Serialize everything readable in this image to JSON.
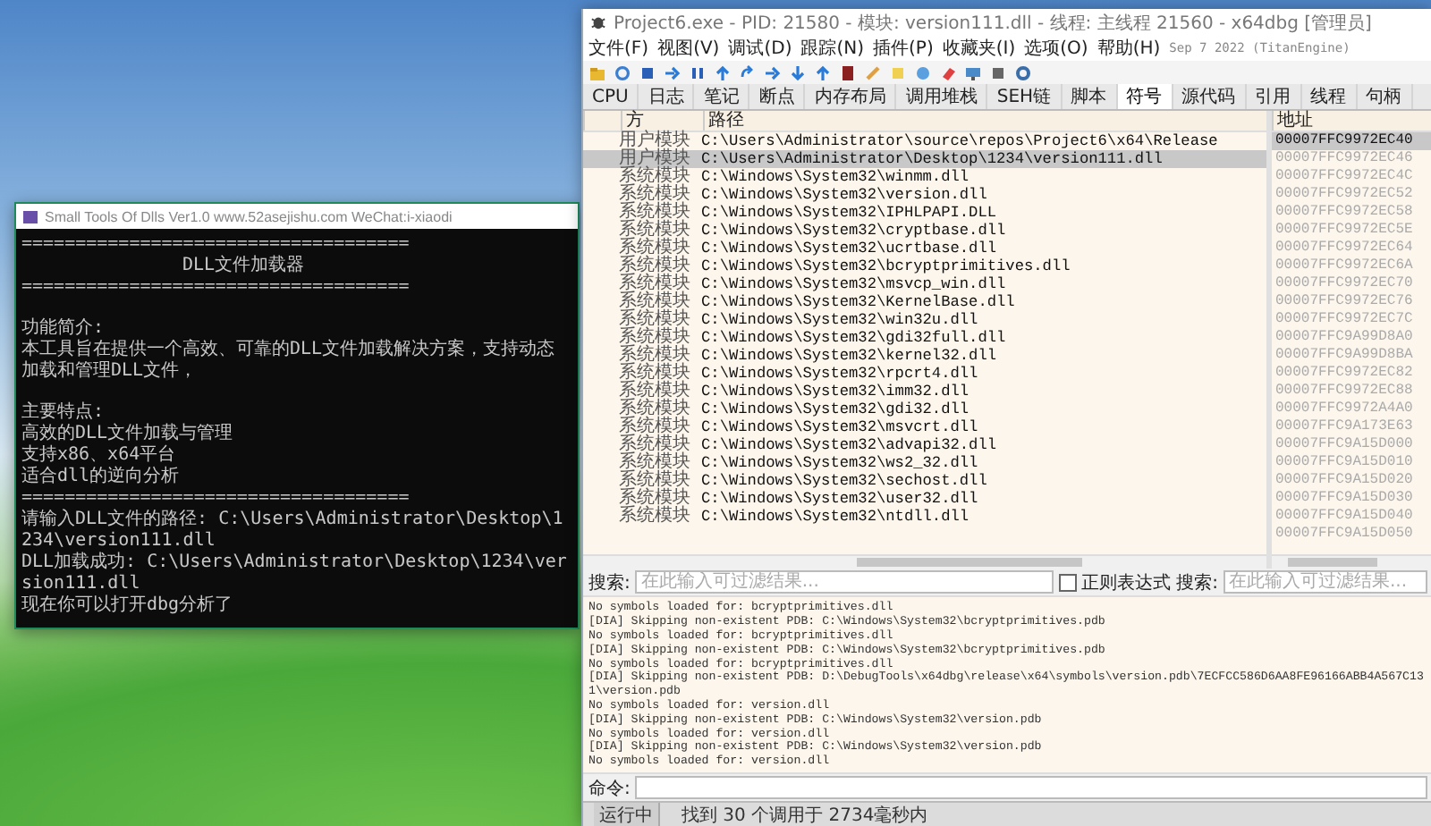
{
  "console": {
    "title": "Small Tools Of Dlls Ver1.0  www.52asejishu.com  WeChat:i-xiaodi",
    "groups": [
      [
        "====================================",
        "DLL文件加载器",
        "===================================="
      ],
      [
        "功能简介:",
        "本工具旨在提供一个高效、可靠的DLL文件加载解决方案，支持动态加载和管理DLL文件，"
      ],
      [
        "主要特点:",
        "高效的DLL文件加载与管理",
        "支持x86、x64平台",
        "适合dll的逆向分析",
        "====================================",
        "请输入DLL文件的路径: C:\\Users\\Administrator\\Desktop\\1234\\version111.dll",
        "DLL加载成功: C:\\Users\\Administrator\\Desktop\\1234\\version111.dll",
        "现在你可以打开dbg分析了"
      ]
    ]
  },
  "debugger": {
    "title": "Project6.exe - PID: 21580 - 模块: version111.dll - 线程: 主线程 21560 - x64dbg [管理员]",
    "menu": [
      "文件(F)",
      "视图(V)",
      "调试(D)",
      "跟踪(N)",
      "插件(P)",
      "收藏夹(I)",
      "选项(O)",
      "帮助(H)"
    ],
    "build_date": "Sep 7 2022 (TitanEngine)",
    "tabs": [
      {
        "label": "CPU",
        "selected": false
      },
      {
        "label": "日志",
        "selected": false
      },
      {
        "label": "笔记",
        "selected": false
      },
      {
        "label": "断点",
        "selected": false
      },
      {
        "label": "内存布局",
        "selected": false
      },
      {
        "label": "调用堆栈",
        "selected": false
      },
      {
        "label": "SEH链",
        "selected": false
      },
      {
        "label": "脚本",
        "selected": false
      },
      {
        "label": "符号",
        "selected": true
      },
      {
        "label": "源代码",
        "selected": false
      },
      {
        "label": "引用",
        "selected": false
      },
      {
        "label": "线程",
        "selected": false
      },
      {
        "label": "句柄",
        "selected": false
      }
    ],
    "modules": {
      "columns": [
        "方",
        "路径"
      ],
      "rows": [
        {
          "type": "用户模块",
          "path": "C:\\Users\\Administrator\\source\\repos\\Project6\\x64\\Release",
          "selected": false
        },
        {
          "type": "用户模块",
          "path": "C:\\Users\\Administrator\\Desktop\\1234\\version111.dll",
          "selected": true
        },
        {
          "type": "系统模块",
          "path": "C:\\Windows\\System32\\winmm.dll",
          "selected": false
        },
        {
          "type": "系统模块",
          "path": "C:\\Windows\\System32\\version.dll",
          "selected": false
        },
        {
          "type": "系统模块",
          "path": "C:\\Windows\\System32\\IPHLPAPI.DLL",
          "selected": false
        },
        {
          "type": "系统模块",
          "path": "C:\\Windows\\System32\\cryptbase.dll",
          "selected": false
        },
        {
          "type": "系统模块",
          "path": "C:\\Windows\\System32\\ucrtbase.dll",
          "selected": false
        },
        {
          "type": "系统模块",
          "path": "C:\\Windows\\System32\\bcryptprimitives.dll",
          "selected": false
        },
        {
          "type": "系统模块",
          "path": "C:\\Windows\\System32\\msvcp_win.dll",
          "selected": false
        },
        {
          "type": "系统模块",
          "path": "C:\\Windows\\System32\\KernelBase.dll",
          "selected": false
        },
        {
          "type": "系统模块",
          "path": "C:\\Windows\\System32\\win32u.dll",
          "selected": false
        },
        {
          "type": "系统模块",
          "path": "C:\\Windows\\System32\\gdi32full.dll",
          "selected": false
        },
        {
          "type": "系统模块",
          "path": "C:\\Windows\\System32\\kernel32.dll",
          "selected": false
        },
        {
          "type": "系统模块",
          "path": "C:\\Windows\\System32\\rpcrt4.dll",
          "selected": false
        },
        {
          "type": "系统模块",
          "path": "C:\\Windows\\System32\\imm32.dll",
          "selected": false
        },
        {
          "type": "系统模块",
          "path": "C:\\Windows\\System32\\gdi32.dll",
          "selected": false
        },
        {
          "type": "系统模块",
          "path": "C:\\Windows\\System32\\msvcrt.dll",
          "selected": false
        },
        {
          "type": "系统模块",
          "path": "C:\\Windows\\System32\\advapi32.dll",
          "selected": false
        },
        {
          "type": "系统模块",
          "path": "C:\\Windows\\System32\\ws2_32.dll",
          "selected": false
        },
        {
          "type": "系统模块",
          "path": "C:\\Windows\\System32\\sechost.dll",
          "selected": false
        },
        {
          "type": "系统模块",
          "path": "C:\\Windows\\System32\\user32.dll",
          "selected": false
        },
        {
          "type": "系统模块",
          "path": "C:\\Windows\\System32\\ntdll.dll",
          "selected": false
        }
      ]
    },
    "addresses": {
      "column": "地址",
      "rows": [
        {
          "value": "00007FFC9972EC40",
          "selected": true
        },
        {
          "value": "00007FFC9972EC46",
          "selected": false
        },
        {
          "value": "00007FFC9972EC4C",
          "selected": false
        },
        {
          "value": "00007FFC9972EC52",
          "selected": false
        },
        {
          "value": "00007FFC9972EC58",
          "selected": false
        },
        {
          "value": "00007FFC9972EC5E",
          "selected": false
        },
        {
          "value": "00007FFC9972EC64",
          "selected": false
        },
        {
          "value": "00007FFC9972EC6A",
          "selected": false
        },
        {
          "value": "00007FFC9972EC70",
          "selected": false
        },
        {
          "value": "00007FFC9972EC76",
          "selected": false
        },
        {
          "value": "00007FFC9972EC7C",
          "selected": false
        },
        {
          "value": "00007FFC9A99D8A0",
          "selected": false
        },
        {
          "value": "00007FFC9A99D8BA",
          "selected": false
        },
        {
          "value": "00007FFC9972EC82",
          "selected": false
        },
        {
          "value": "00007FFC9972EC88",
          "selected": false
        },
        {
          "value": "00007FFC9972A4A0",
          "selected": false
        },
        {
          "value": "00007FFC9A173E63",
          "selected": false
        },
        {
          "value": "00007FFC9A15D000",
          "selected": false
        },
        {
          "value": "00007FFC9A15D010",
          "selected": false
        },
        {
          "value": "00007FFC9A15D020",
          "selected": false
        },
        {
          "value": "00007FFC9A15D030",
          "selected": false
        },
        {
          "value": "00007FFC9A15D040",
          "selected": false
        },
        {
          "value": "00007FFC9A15D050",
          "selected": false
        }
      ]
    },
    "search": {
      "label": "搜索:",
      "placeholder": "在此输入可过滤结果..."
    },
    "regex": {
      "label": "正则表达式",
      "checked": false
    },
    "search_right": {
      "label": "搜索:",
      "placeholder": "在此输入可过滤结果..."
    },
    "log": [
      "No symbols loaded for: bcryptprimitives.dll",
      "[DIA] Skipping non-existent PDB: C:\\Windows\\System32\\bcryptprimitives.pdb",
      "No symbols loaded for: bcryptprimitives.dll",
      "[DIA] Skipping non-existent PDB: C:\\Windows\\System32\\bcryptprimitives.pdb",
      "No symbols loaded for: bcryptprimitives.dll",
      "[DIA] Skipping non-existent PDB: D:\\DebugTools\\x64dbg\\release\\x64\\symbols\\version.pdb\\7ECFCC586D6AA8FE96166ABB4A567C131\\version.pdb",
      "No symbols loaded for: version.dll",
      "[DIA] Skipping non-existent PDB: C:\\Windows\\System32\\version.pdb",
      "No symbols loaded for: version.dll",
      "[DIA] Skipping non-existent PDB: C:\\Windows\\System32\\version.pdb",
      "No symbols loaded for: version.dll"
    ],
    "command": {
      "label": "命令:"
    },
    "status": {
      "state": "运行中",
      "message": "找到 30 个调用于 2734毫秒内"
    }
  }
}
